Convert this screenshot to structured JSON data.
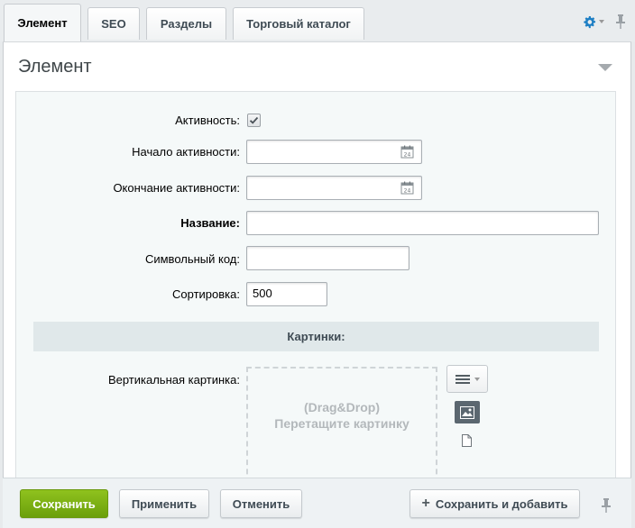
{
  "tabs": [
    {
      "label": "Элемент",
      "active": true
    },
    {
      "label": "SEO",
      "active": false
    },
    {
      "label": "Разделы",
      "active": false
    },
    {
      "label": "Торговый каталог",
      "active": false
    }
  ],
  "toolbar": {
    "settings_icon": "gear-icon",
    "pin_icon": "pin-icon"
  },
  "section": {
    "title": "Элемент"
  },
  "form": {
    "active_label": "Активность:",
    "active_checked": true,
    "start_label": "Начало активности:",
    "start_value": "",
    "end_label": "Окончание активности:",
    "end_value": "",
    "name_label": "Название:",
    "name_value": "",
    "code_label": "Символьный код:",
    "code_value": "",
    "sort_label": "Сортировка:",
    "sort_value": "500"
  },
  "pictures": {
    "group_label": "Картинки:",
    "vertical_label": "Вертикальная картинка:",
    "drop_line1": "(Drag&Drop)",
    "drop_line2": "Перетащите картинку"
  },
  "footer": {
    "save": "Сохранить",
    "apply": "Применить",
    "cancel": "Отменить",
    "save_add": "Сохранить и добавить"
  },
  "colors": {
    "primary_button": "#7cb014",
    "gear_icon": "#1e7fc4",
    "group_header_bg": "#e0e8ea"
  }
}
